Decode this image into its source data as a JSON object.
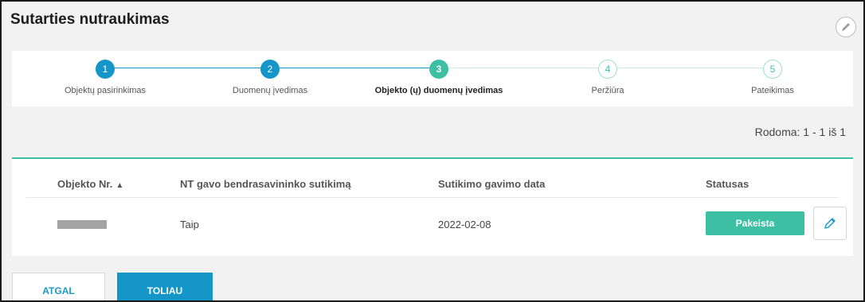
{
  "page": {
    "title": "Sutarties nutraukimas"
  },
  "stepper": {
    "steps": [
      {
        "number": "1",
        "label": "Objektų pasirinkimas",
        "state": "done"
      },
      {
        "number": "2",
        "label": "Duomenų įvedimas",
        "state": "done"
      },
      {
        "number": "3",
        "label": "Objekto (ų) duomenų įvedimas",
        "state": "current"
      },
      {
        "number": "4",
        "label": "Peržiūra",
        "state": "pending"
      },
      {
        "number": "5",
        "label": "Pateikimas",
        "state": "pending"
      }
    ]
  },
  "pagination": {
    "showing": "Rodoma: 1 - 1 iš 1"
  },
  "table": {
    "columns": [
      "Objekto Nr.",
      "NT gavo bendrasavininko sutikimą",
      "Sutikimo gavimo data",
      "Statusas"
    ],
    "sort_indicator": "▲",
    "rows": [
      {
        "object_nr": "",
        "consent": "Taip",
        "date": "2022-02-08",
        "status": "Pakeista"
      }
    ]
  },
  "actions": {
    "back_label": "ATGAL",
    "next_label": "TOLIAU"
  },
  "colors": {
    "done": "#1496c8",
    "current": "#3cbfa3",
    "pending_border": "#9fdfd0",
    "accent": "#3cbfa3"
  },
  "icons": {
    "header_edit": "pencil-icon",
    "row_edit": "pencil-icon"
  }
}
